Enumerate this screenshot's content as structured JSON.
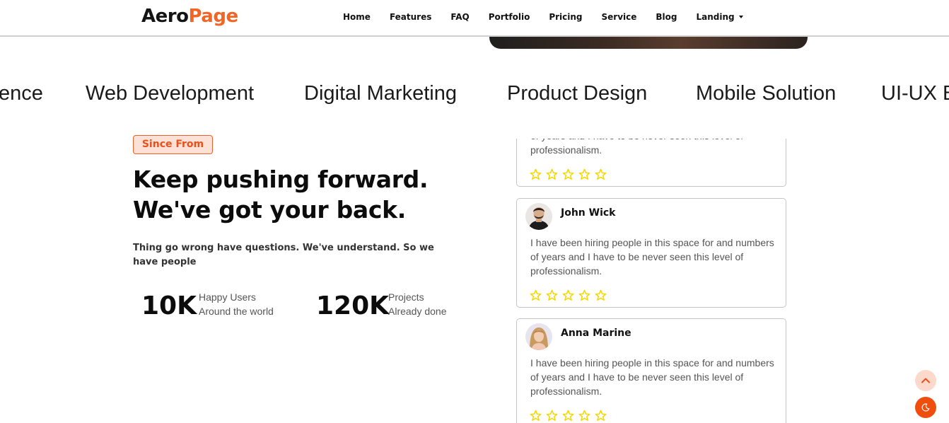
{
  "brand": {
    "part1": "Aero",
    "part2": "Page"
  },
  "nav": [
    {
      "label": "Home"
    },
    {
      "label": "Features"
    },
    {
      "label": "FAQ"
    },
    {
      "label": "Portfolio"
    },
    {
      "label": "Pricing"
    },
    {
      "label": "Service"
    },
    {
      "label": "Blog"
    },
    {
      "label": "Landing"
    }
  ],
  "marquee": [
    "ence",
    "Web Development",
    "Digital Marketing",
    "Product Design",
    "Mobile Solution",
    "UI-UX B"
  ],
  "about": {
    "badge": "Since From",
    "headline_line1": "Keep pushing forward.",
    "headline_line2": "We've got your back.",
    "description": "Thing go wrong have questions. We've understand. So we have people",
    "stats": [
      {
        "number": "10K",
        "line1": "Happy Users",
        "line2": "Around the world"
      },
      {
        "number": "120K",
        "line1": "Projects",
        "line2": "Already done"
      }
    ]
  },
  "reviews": [
    {
      "name": "",
      "text": "I have been hiring people in this space for and numbers of years and I have to be never seen this level of professionalism.",
      "rating": 5
    },
    {
      "name": "John Wick",
      "text": "I have been hiring people in this space for and numbers of years and I have to be never seen this level of professionalism.",
      "rating": 5
    },
    {
      "name": "Anna Marine",
      "text": "I have been hiring people in this space for and numbers of years and I have to be never seen this level of professionalism.",
      "rating": 5
    }
  ],
  "colors": {
    "accent": "#f26522",
    "badge_bg": "#fde1d6",
    "star": "#f5d800"
  },
  "icons": {
    "scroll_top": "chevron-up-icon",
    "theme": "moon-icon"
  }
}
